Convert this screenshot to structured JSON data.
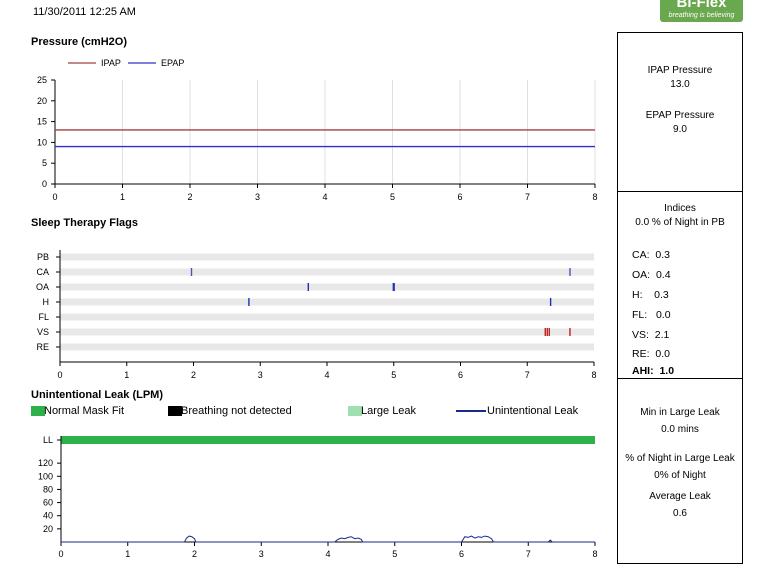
{
  "header": {
    "date": "11/30/2011 12:25 AM",
    "logo_text": "Bi-Flex",
    "logo_tagline": "breathing is believing"
  },
  "colors": {
    "ipap": "#a04040",
    "epap": "#3030c8",
    "flag": "#6040b0",
    "normal_fit": "#2db14a",
    "breathing_not_detected": "#000000",
    "large_leak": "#9fdfb0",
    "leak_line": "#1a2a8a",
    "grid": "#e0e0e0"
  },
  "sections": {
    "pressure": "Pressure (cmH2O)",
    "flags": "Sleep Therapy Flags",
    "leak": "Unintentional Leak (LPM)"
  },
  "legend": {
    "ipap": "IPAP",
    "epap": "EPAP",
    "normal": "Normal Mask Fit",
    "breathing": "Breathing not detected",
    "large_leak": "Large Leak",
    "unintentional": "Unintentional Leak"
  },
  "panel_pressure": {
    "ipap_label": "IPAP Pressure",
    "ipap_value": "13.0",
    "epap_label": "EPAP Pressure",
    "epap_value": "9.0"
  },
  "panel_indices": {
    "title": "Indices",
    "pb_line": "0.0 % of Night in PB",
    "rows": [
      {
        "label": "CA:",
        "value": "0.3"
      },
      {
        "label": "OA:",
        "value": "0.4"
      },
      {
        "label": "H:",
        "value": "0.3"
      },
      {
        "label": "FL:",
        "value": "0.0"
      },
      {
        "label": "VS:",
        "value": "2.1"
      },
      {
        "label": "RE:",
        "value": "0.0"
      }
    ],
    "ahi_label": "AHI:",
    "ahi_value": "1.0"
  },
  "panel_leak": {
    "min_label": "Min in Large Leak",
    "min_value": "0.0 mins",
    "pct_label": "% of Night in Large Leak",
    "pct_value": "0% of Night",
    "avg_label": "Average Leak",
    "avg_value": "0.6"
  },
  "chart_data": [
    {
      "type": "line",
      "title": "Pressure (cmH2O)",
      "xlim": [
        0,
        8
      ],
      "ylim": [
        0,
        25
      ],
      "x_ticks": [
        "0",
        "1",
        "2",
        "3",
        "4",
        "5",
        "6",
        "7",
        "8"
      ],
      "y_ticks": [
        "0",
        "5",
        "10",
        "15",
        "20",
        "25"
      ],
      "grid": "vertical",
      "legend_position": "top-left",
      "series": [
        {
          "name": "IPAP",
          "x": [
            0,
            8
          ],
          "y": [
            13,
            13
          ]
        },
        {
          "name": "EPAP",
          "x": [
            0,
            8
          ],
          "y": [
            9,
            9
          ]
        }
      ]
    },
    {
      "type": "scatter",
      "title": "Sleep Therapy Flags",
      "xlim": [
        0,
        8
      ],
      "x_ticks": [
        "0",
        "1",
        "2",
        "3",
        "4",
        "5",
        "6",
        "7",
        "8"
      ],
      "rows": [
        "PB",
        "CA",
        "OA",
        "H",
        "FL",
        "VS",
        "RE"
      ],
      "events": [
        {
          "row": "CA",
          "x": 1.97
        },
        {
          "row": "CA",
          "x": 7.64
        },
        {
          "row": "OA",
          "x": 3.72
        },
        {
          "row": "OA",
          "x": 5.0
        },
        {
          "row": "H",
          "x": 2.83
        },
        {
          "row": "H",
          "x": 7.35
        },
        {
          "row": "VS",
          "x": 7.27
        },
        {
          "row": "VS",
          "x": 7.3
        },
        {
          "row": "VS",
          "x": 7.33
        },
        {
          "row": "VS",
          "x": 7.64
        }
      ]
    },
    {
      "type": "area",
      "title": "Unintentional Leak (LPM)",
      "xlim": [
        0,
        8
      ],
      "ylim": [
        0,
        140
      ],
      "x_ticks": [
        "0",
        "1",
        "2",
        "3",
        "4",
        "5",
        "6",
        "7",
        "8"
      ],
      "y_ticks": [
        "LL",
        "120",
        "100",
        "80",
        "60",
        "40",
        "20"
      ],
      "status_band": "Normal Mask Fit",
      "series": [
        {
          "name": "Unintentional Leak",
          "x": [
            0,
            1.85,
            1.88,
            1.92,
            1.96,
            2.0,
            2.02,
            4.1,
            4.15,
            4.2,
            4.25,
            4.3,
            4.35,
            4.4,
            4.45,
            4.5,
            4.52,
            6.0,
            6.05,
            6.1,
            6.15,
            6.2,
            6.25,
            6.3,
            6.35,
            6.4,
            6.45,
            6.48,
            7.3,
            7.33,
            7.36,
            8
          ],
          "y": [
            0,
            0,
            6,
            9,
            8,
            5,
            0,
            0,
            4,
            6,
            5,
            7,
            8,
            5,
            6,
            4,
            0,
            0,
            8,
            7,
            9,
            6,
            8,
            7,
            9,
            8,
            5,
            0,
            0,
            3,
            0,
            0
          ]
        }
      ]
    }
  ]
}
